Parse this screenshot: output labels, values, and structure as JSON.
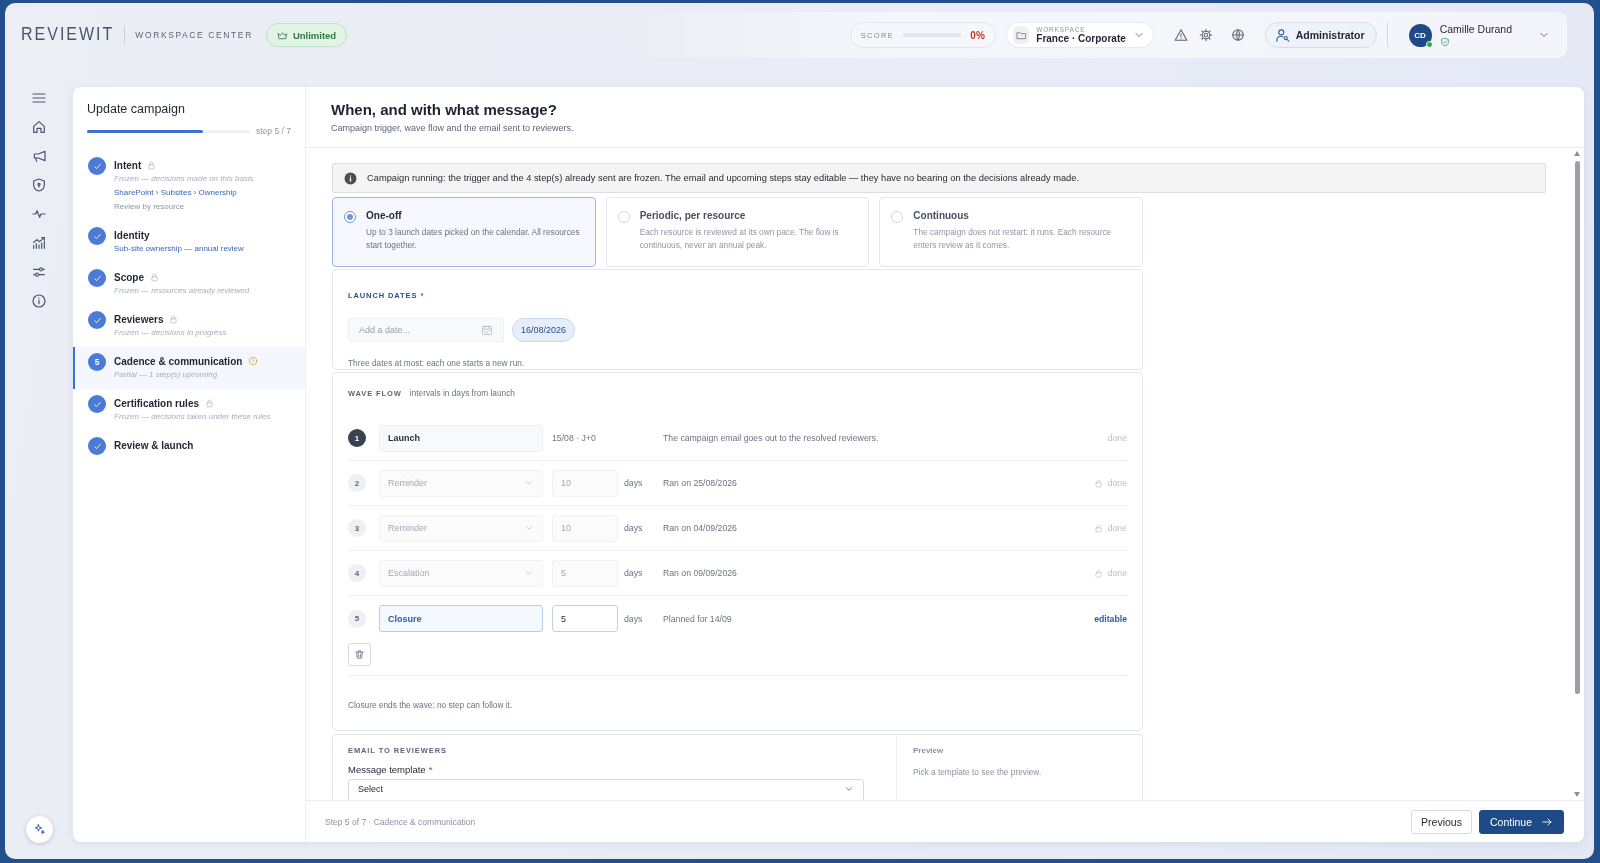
{
  "header": {
    "logo": "REVIEWIT",
    "product": "WORKSPACE CENTER",
    "plan_badge": "Unlimited",
    "score": {
      "label": "SCORE",
      "level": 0,
      "value": "0%"
    },
    "workspace": {
      "label": "WORKSPACE",
      "value": "France · Corporate"
    },
    "role": "Administrator",
    "user": {
      "initials": "CD",
      "name": "Camille Durand",
      "online": true
    }
  },
  "wizard": {
    "title": "Update campaign",
    "progress": {
      "level": 0.71,
      "label": "step 5 / 7"
    },
    "steps": [
      {
        "title": "Intent",
        "locked": true,
        "pending": false,
        "done": true,
        "selected": false,
        "lines": [
          {
            "kind": "note",
            "text": "Frozen — decisions made on this basis"
          },
          {
            "kind": "link",
            "text": "SharePoint › Subsites › Ownership"
          },
          {
            "kind": "plain",
            "text": "Review by resource"
          }
        ]
      },
      {
        "title": "Identity",
        "locked": false,
        "pending": false,
        "done": true,
        "selected": false,
        "lines": [
          {
            "kind": "link",
            "text": "Sub-site ownership — annual review"
          }
        ]
      },
      {
        "title": "Scope",
        "locked": true,
        "pending": false,
        "done": true,
        "selected": false,
        "lines": [
          {
            "kind": "note",
            "text": "Frozen — resources already reviewed"
          }
        ]
      },
      {
        "title": "Reviewers",
        "locked": true,
        "pending": false,
        "done": true,
        "selected": false,
        "lines": [
          {
            "kind": "note",
            "text": "Frozen — decisions in progress"
          }
        ]
      },
      {
        "title": "Cadence & communication",
        "locked": false,
        "pending": true,
        "done": false,
        "number": "5",
        "selected": true,
        "lines": [
          {
            "kind": "note",
            "text": "Partial — 1 step(s) upcoming"
          }
        ]
      },
      {
        "title": "Certification rules",
        "locked": true,
        "pending": false,
        "done": true,
        "selected": false,
        "lines": [
          {
            "kind": "note",
            "text": "Frozen — decisions taken under these rules"
          }
        ]
      },
      {
        "title": "Review & launch",
        "locked": false,
        "pending": false,
        "done": true,
        "selected": false
      }
    ]
  },
  "page": {
    "title": "When, and with what message?",
    "subtitle": "Campaign trigger, wave flow and the email sent to reviewers."
  },
  "notice": "Campaign running: the trigger and the 4 step(s) already sent are frozen. The email and upcoming steps stay editable — they have no bearing on the decisions already made.",
  "trigger_options": [
    {
      "title": "One-off",
      "description": "Up to 3 launch dates picked on the calendar. All resources start together.",
      "selected": true
    },
    {
      "title": "Periodic, per resource",
      "description": "Each resource is reviewed at its own pace. The flow is continuous, never an annual peak.",
      "selected": false
    },
    {
      "title": "Continuous",
      "description": "The campaign does not restart: it runs. Each resource enters review as it comes.",
      "selected": false
    }
  ],
  "launch_dates": {
    "label": "LAUNCH DATES",
    "required_mark": "*",
    "date_field": {
      "placeholder": "Add a date..."
    },
    "dates": [
      "16/08/2026"
    ],
    "hint": "Three dates at most: each one starts a new run."
  },
  "wave_flow": {
    "label": "WAVE FLOW",
    "hint": "intervals in days from launch",
    "steps": [
      {
        "kind": "launch",
        "number": "1",
        "name": "Launch",
        "timing": "15/08 · J+0",
        "description": "The campaign email goes out to the resolved reviewers.",
        "status": "done"
      },
      {
        "kind": "frozen",
        "number": "2",
        "name": "Reminder",
        "days": "10",
        "unit": "days",
        "description": "Ran on 25/08/2026",
        "status": "done"
      },
      {
        "kind": "frozen",
        "number": "3",
        "name": "Reminder",
        "days": "10",
        "unit": "days",
        "description": "Ran on 04/09/2026",
        "status": "done"
      },
      {
        "kind": "frozen",
        "number": "4",
        "name": "Escalation",
        "days": "5",
        "unit": "days",
        "description": "Ran on 09/09/2026",
        "status": "done"
      },
      {
        "kind": "editable",
        "number": "5",
        "name": "Closure",
        "days": "5",
        "unit": "days",
        "description": "Planned for 14/09",
        "status": "editable"
      }
    ],
    "note": "Closure ends the wave: no step can follow it."
  },
  "email": {
    "label": "EMAIL TO REVIEWERS",
    "template": {
      "label": "Message template",
      "required_mark": "*",
      "value": "Select"
    },
    "preview": {
      "label": "Preview",
      "text": "Pick a template to see the preview."
    }
  },
  "footer": {
    "status": "Step 5 of 7 · Cadence & communication",
    "buttons": [
      {
        "label": "Previous",
        "kind": "secondary"
      },
      {
        "label": "Continue",
        "kind": "primary"
      }
    ]
  }
}
